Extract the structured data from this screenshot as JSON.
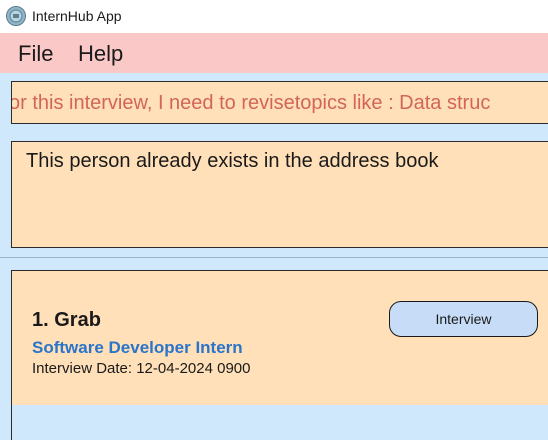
{
  "window": {
    "title": "InternHub App",
    "icon": "app-logo-icon"
  },
  "menu": {
    "items": [
      {
        "label": "File"
      },
      {
        "label": "Help"
      }
    ]
  },
  "command_box": {
    "value": "or this interview, I need to revisetopics like : Data struc"
  },
  "result_display": {
    "text": "This person already exists in the address book"
  },
  "internships": [
    {
      "index_title": "1.  Grab",
      "role": "Software Developer Intern",
      "date_text": "Interview Date: 12-04-2024 0900",
      "status_label": "Interview"
    }
  ],
  "colors": {
    "menubar": "#fbc8c8",
    "panel": "#ffe0b8",
    "background": "#cfe8fb",
    "command_text": "#d2655a",
    "role_text": "#2a74c9",
    "status_button": "#c6dcf7"
  }
}
